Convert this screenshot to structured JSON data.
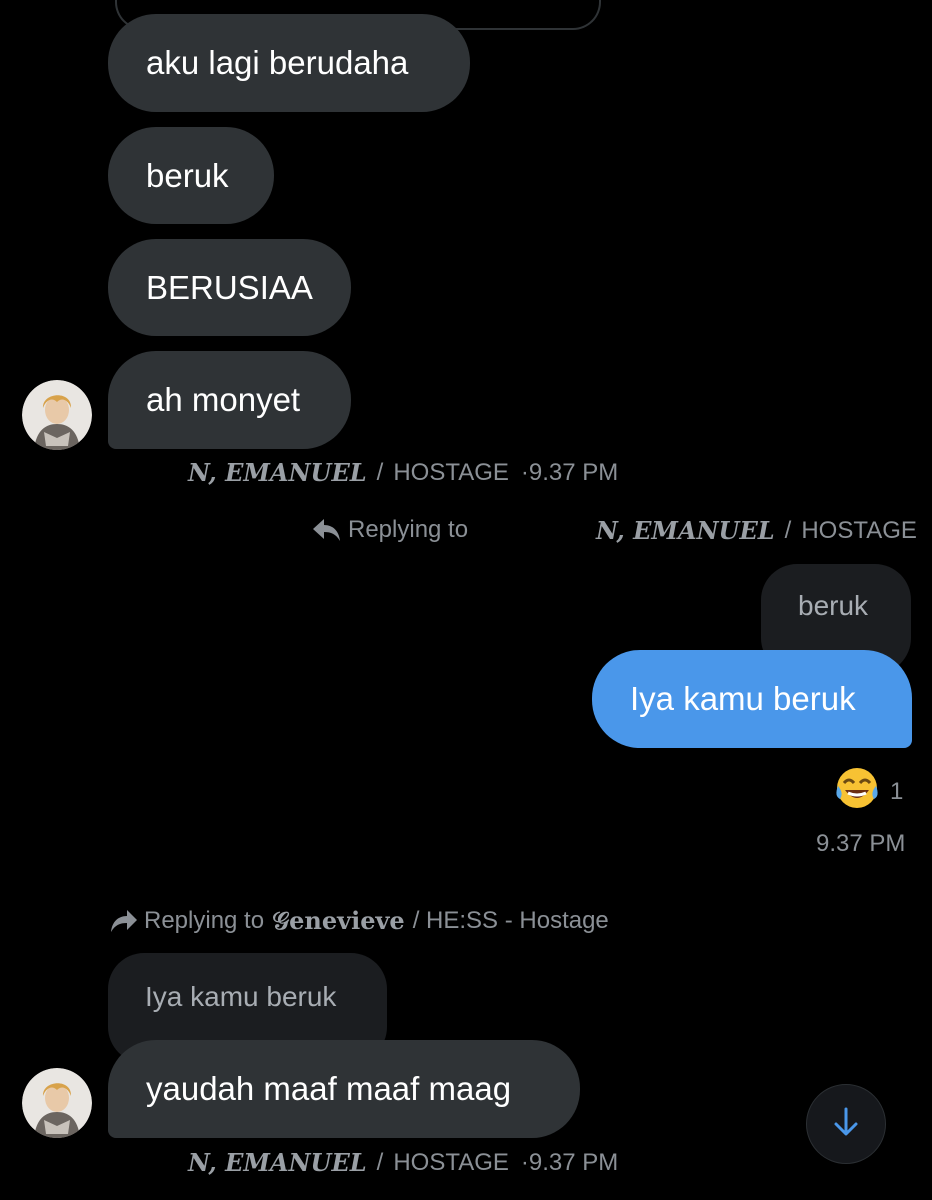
{
  "messages": [
    {
      "text": "aku lagi berudaha"
    },
    {
      "text": "beruk"
    },
    {
      "text": "BERUSIAA"
    },
    {
      "text": "ah monyet"
    }
  ],
  "meta1": {
    "name": "N, EMANUEL",
    "separator": "/",
    "group": "HOSTAGE",
    "time": "·9.37 PM"
  },
  "reply1": {
    "label": "Replying to",
    "name": "N, EMANUEL",
    "separator": "/",
    "group": "HOSTAGE",
    "quoted": "beruk"
  },
  "outgoing": {
    "text": "Iya kamu beruk",
    "reaction_count": "1",
    "time": "9.37 PM"
  },
  "reply2": {
    "label": "Replying to",
    "name": "𝒢enevieve",
    "rest": "/ HE:SS - Hostage",
    "quoted": "Iya kamu beruk"
  },
  "incoming_last": {
    "text": "yaudah maaf maaf maag"
  },
  "meta2": {
    "name": "N, EMANUEL",
    "separator": "/",
    "group": "HOSTAGE",
    "time": "·9.37 PM"
  },
  "icons": {
    "reply": "reply-arrow-icon",
    "reaction": "laugh-cry-emoji-icon",
    "scroll": "arrow-down-icon"
  },
  "colors": {
    "background": "#000000",
    "incoming_bubble": "#2f3336",
    "outgoing_bubble": "#4a97ea",
    "accent": "#4a97ea"
  }
}
